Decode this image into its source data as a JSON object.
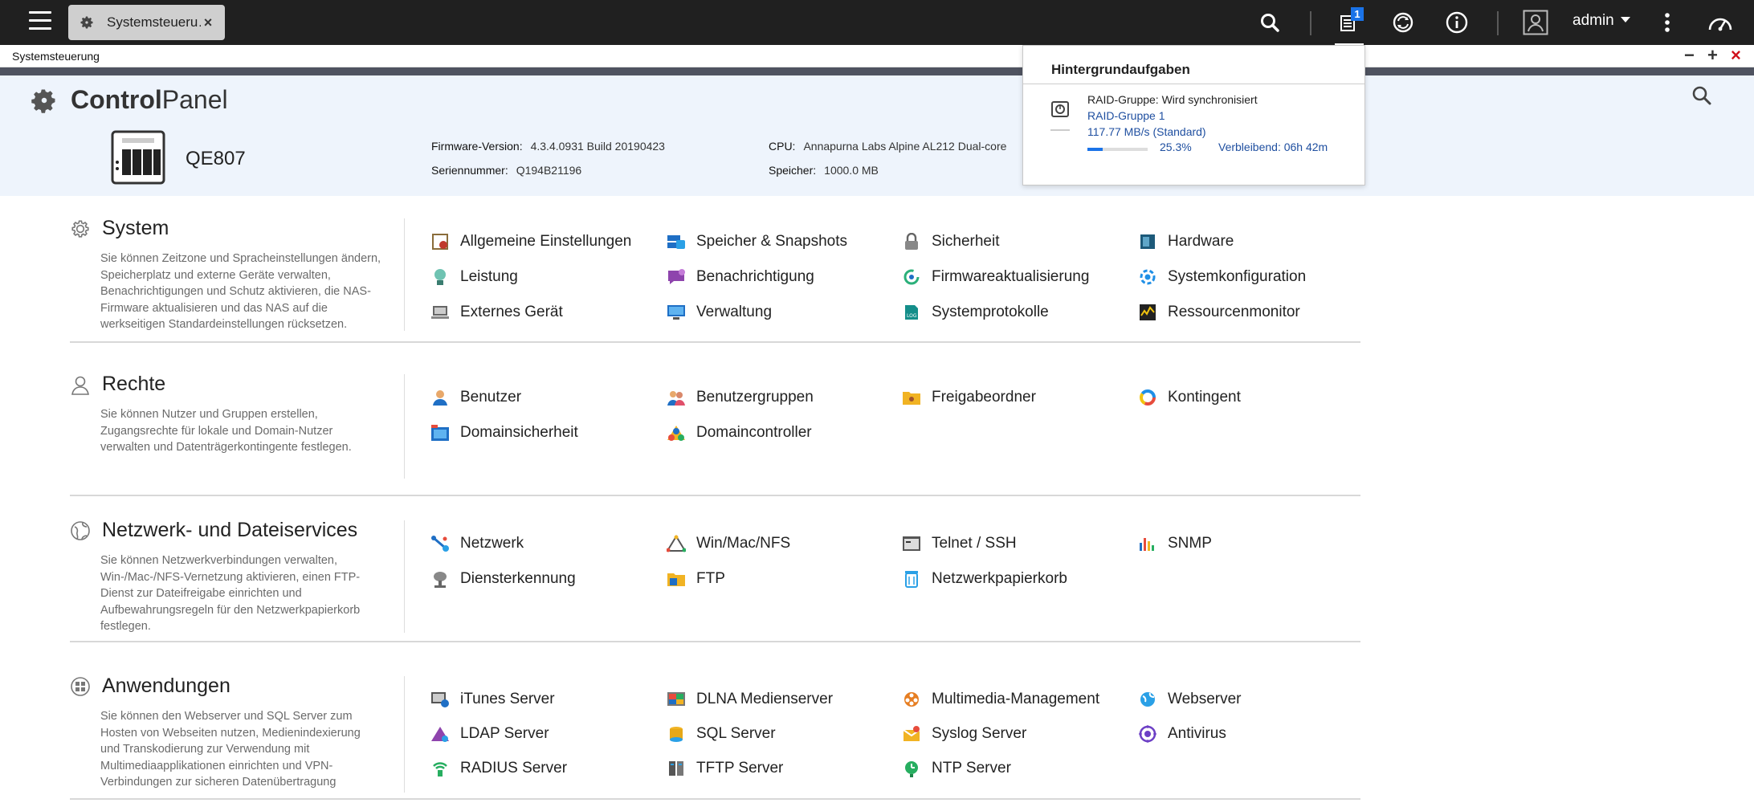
{
  "topbar": {
    "tab_label": "Systemsteueru…",
    "tab_close": "×",
    "badge_count": "1",
    "user": "admin"
  },
  "window": {
    "title": "Systemsteuerung",
    "min": "−",
    "max": "+",
    "close": "×"
  },
  "header": {
    "brand_bold": "Control",
    "brand_rest": "Panel",
    "nas_name": "QE807",
    "firmware_label": "Firmware-Version:",
    "firmware_value": "4.3.4.0931 Build 20190423",
    "serial_label": "Seriennummer:",
    "serial_value": "Q194B21196",
    "cpu_label": "CPU:",
    "cpu_value": "Annapurna Labs Alpine AL212 Dual-core",
    "memory_label": "Speicher:",
    "memory_value": "1000.0 MB"
  },
  "popup": {
    "title": "Hintergrundaufgaben",
    "task": "RAID-Gruppe: Wird synchronisiert",
    "group": "RAID-Gruppe 1",
    "speed": "117.77 MB/s (Standard)",
    "progress_text": "25.3%",
    "progress_value": 25.3,
    "remaining": "Verbleibend: 06h 42m"
  },
  "sections": [
    {
      "title": "System",
      "desc": "Sie können Zeitzone und Spracheinstellungen ändern, Speicherplatz und externe Geräte verwalten, Benachrichtigungen und Schutz aktivieren, die NAS-Firmware aktualisieren und das NAS auf die werkseitigen Standardeinstellungen rücksetzen.",
      "items": [
        "Allgemeine Einstellungen",
        "Speicher & Snapshots",
        "Sicherheit",
        "Hardware",
        "Leistung",
        "Benachrichtigung",
        "Firmwareaktualisierung",
        "Systemkonfiguration",
        "Externes Gerät",
        "Verwaltung",
        "Systemprotokolle",
        "Ressourcenmonitor"
      ]
    },
    {
      "title": "Rechte",
      "desc": "Sie können Nutzer und Gruppen erstellen, Zugangsrechte für lokale und Domain-Nutzer verwalten und Datenträgerkontingente festlegen.",
      "items": [
        "Benutzer",
        "Benutzergruppen",
        "Freigabeordner",
        "Kontingent",
        "Domainsicherheit",
        "Domaincontroller"
      ]
    },
    {
      "title": "Netzwerk- und Dateiservices",
      "desc": "Sie können Netzwerkverbindungen verwalten, Win-/Mac-/NFS-Vernetzung aktivieren, einen FTP-Dienst zur Dateifreigabe einrichten und Aufbewahrungsregeln für den Netzwerkpapierkorb festlegen.",
      "items": [
        "Netzwerk",
        "Win/Mac/NFS",
        "Telnet / SSH",
        "SNMP",
        "Diensterkennung",
        "FTP",
        "Netzwerkpapierkorb"
      ]
    },
    {
      "title": "Anwendungen",
      "desc": "Sie können den Webserver und SQL Server zum Hosten von Webseiten nutzen, Medienindexierung und Transkodierung zur Verwendung mit Multimediaapplikationen einrichten und VPN-Verbindungen zur sicheren Datenübertragung",
      "items": [
        "iTunes Server",
        "DLNA Medienserver",
        "Multimedia-Management",
        "Webserver",
        "LDAP Server",
        "SQL Server",
        "Syslog Server",
        "Antivirus",
        "RADIUS Server",
        "TFTP Server",
        "NTP Server"
      ]
    }
  ]
}
